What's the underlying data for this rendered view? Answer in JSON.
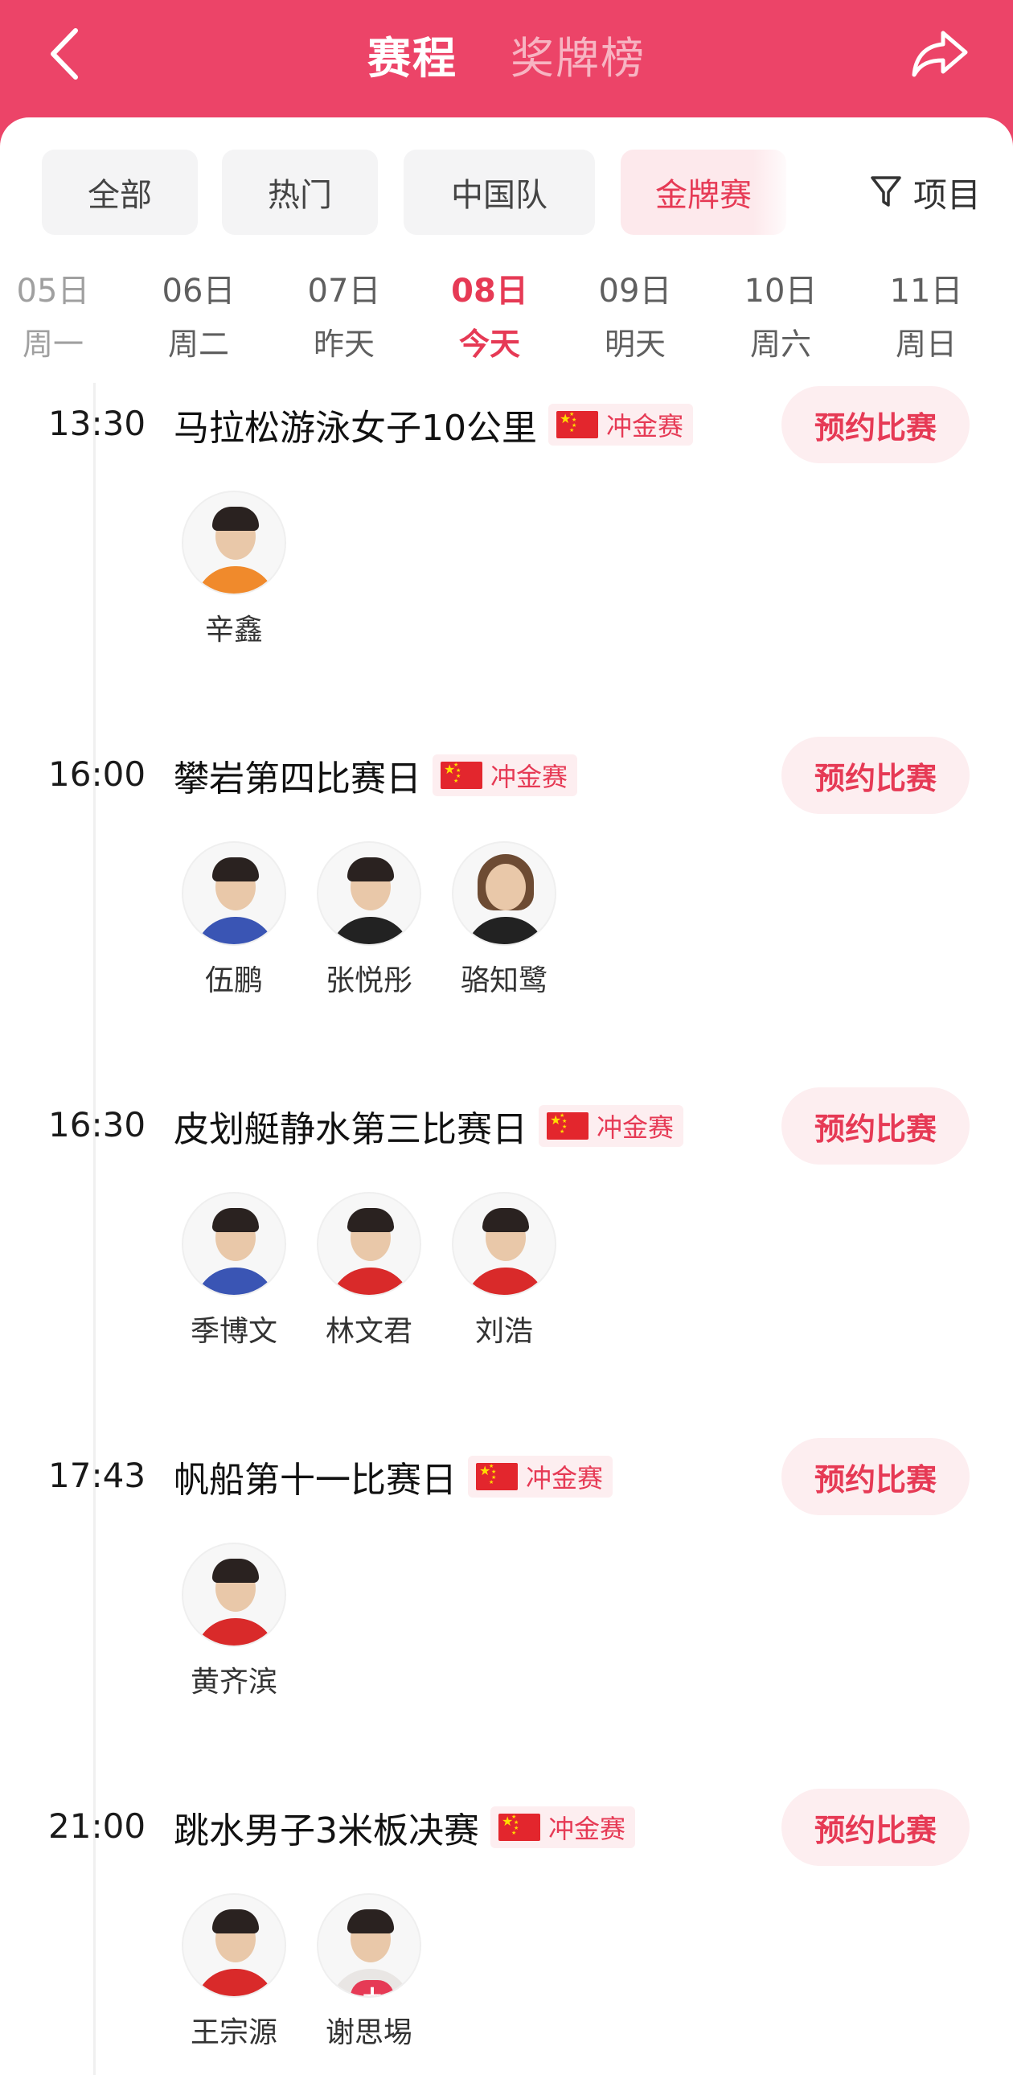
{
  "header": {
    "tabs": [
      {
        "label": "赛程",
        "active": true
      },
      {
        "label": "奖牌榜",
        "active": false
      }
    ],
    "back_icon": "chevron-left-icon",
    "share_icon": "share-arrow-icon"
  },
  "filters": {
    "chips": [
      {
        "label": "全部",
        "active": false
      },
      {
        "label": "热门",
        "active": false
      },
      {
        "label": "中国队",
        "active": false
      },
      {
        "label": "金牌赛",
        "active": true
      }
    ],
    "project_label": "项目",
    "project_icon": "filter-funnel-icon"
  },
  "dates": [
    {
      "day": "05日",
      "week": "周一",
      "active": false
    },
    {
      "day": "06日",
      "week": "周二",
      "active": false
    },
    {
      "day": "07日",
      "week": "昨天",
      "active": false
    },
    {
      "day": "08日",
      "week": "今天",
      "active": true
    },
    {
      "day": "09日",
      "week": "明天",
      "active": false
    },
    {
      "day": "10日",
      "week": "周六",
      "active": false
    },
    {
      "day": "11日",
      "week": "周日",
      "active": false
    }
  ],
  "badge_label": "冲金赛",
  "reserve_label": "预约比赛",
  "events": [
    {
      "time": "13:30",
      "title": "马拉松游泳女子10公里",
      "athletes": [
        {
          "name": "辛鑫",
          "style": "orange"
        }
      ]
    },
    {
      "time": "16:00",
      "title": "攀岩第四比赛日",
      "athletes": [
        {
          "name": "伍鹏",
          "style": "blue"
        },
        {
          "name": "张悦彤",
          "style": "black"
        },
        {
          "name": "骆知鹭",
          "style": "black longhair"
        }
      ]
    },
    {
      "time": "16:30",
      "title": "皮划艇静水第三比赛日",
      "athletes": [
        {
          "name": "季博文",
          "style": "blue"
        },
        {
          "name": "林文君",
          "style": "red"
        },
        {
          "name": "刘浩",
          "style": "red"
        }
      ]
    },
    {
      "time": "17:43",
      "title": "帆船第十一比赛日",
      "athletes": [
        {
          "name": "黄齐滨",
          "style": "red"
        }
      ]
    },
    {
      "time": "21:00",
      "title": "跳水男子3米板决赛",
      "athletes": [
        {
          "name": "王宗源",
          "style": "red"
        },
        {
          "name": "谢思埸",
          "style": "white",
          "plus": true
        }
      ]
    }
  ],
  "colors": {
    "brand": "#ec4468",
    "accent": "#e63a55",
    "badge_bg": "#fdeef0"
  }
}
